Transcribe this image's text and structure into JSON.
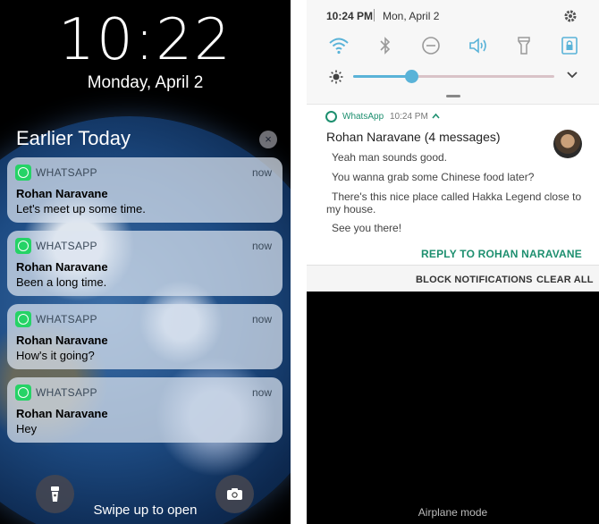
{
  "ios": {
    "time": "10:22",
    "date": "Monday, April 2",
    "section_title": "Earlier Today",
    "clear_glyph": "×",
    "notifications": [
      {
        "app": "WHATSAPP",
        "when": "now",
        "sender": "Rohan Naravane",
        "body": "Let's meet up some time."
      },
      {
        "app": "WHATSAPP",
        "when": "now",
        "sender": "Rohan Naravane",
        "body": "Been a long time."
      },
      {
        "app": "WHATSAPP",
        "when": "now",
        "sender": "Rohan Naravane",
        "body": "How's it going?"
      },
      {
        "app": "WHATSAPP",
        "when": "now",
        "sender": "Rohan Naravane",
        "body": "Hey"
      }
    ],
    "flashlight_icon": "flashlight-icon",
    "camera_icon": "camera-icon",
    "swipe_text": "Swipe up to open"
  },
  "android": {
    "status": {
      "time": "10:24 PM",
      "date": "Mon, April 2"
    },
    "quick_settings": [
      {
        "icon": "wifi-icon",
        "active": true
      },
      {
        "icon": "bluetooth-icon",
        "active": false
      },
      {
        "icon": "do-not-disturb-icon",
        "active": false
      },
      {
        "icon": "sound-icon",
        "active": true
      },
      {
        "icon": "flashlight-icon",
        "active": false
      },
      {
        "icon": "screen-lock-icon",
        "active": true
      }
    ],
    "brightness": {
      "level": 0.29
    },
    "notification": {
      "app": "WhatsApp",
      "time": "10:24 PM",
      "title": "Rohan Naravane (4 messages)",
      "messages": [
        "Yeah man sounds good.",
        "You wanna grab some Chinese food later?",
        "There's this nice place called Hakka Legend close to",
        "my house.",
        "See you there!"
      ],
      "reply_label": "REPLY TO ROHAN NARAVANE"
    },
    "actions": {
      "block": "BLOCK NOTIFICATIONS",
      "clear": "CLEAR ALL"
    },
    "footer": "Airplane mode",
    "colors": {
      "accent": "#5ab3d8",
      "whatsapp_green": "#1d8f6f",
      "inactive_icon": "#9a9a9a"
    }
  }
}
